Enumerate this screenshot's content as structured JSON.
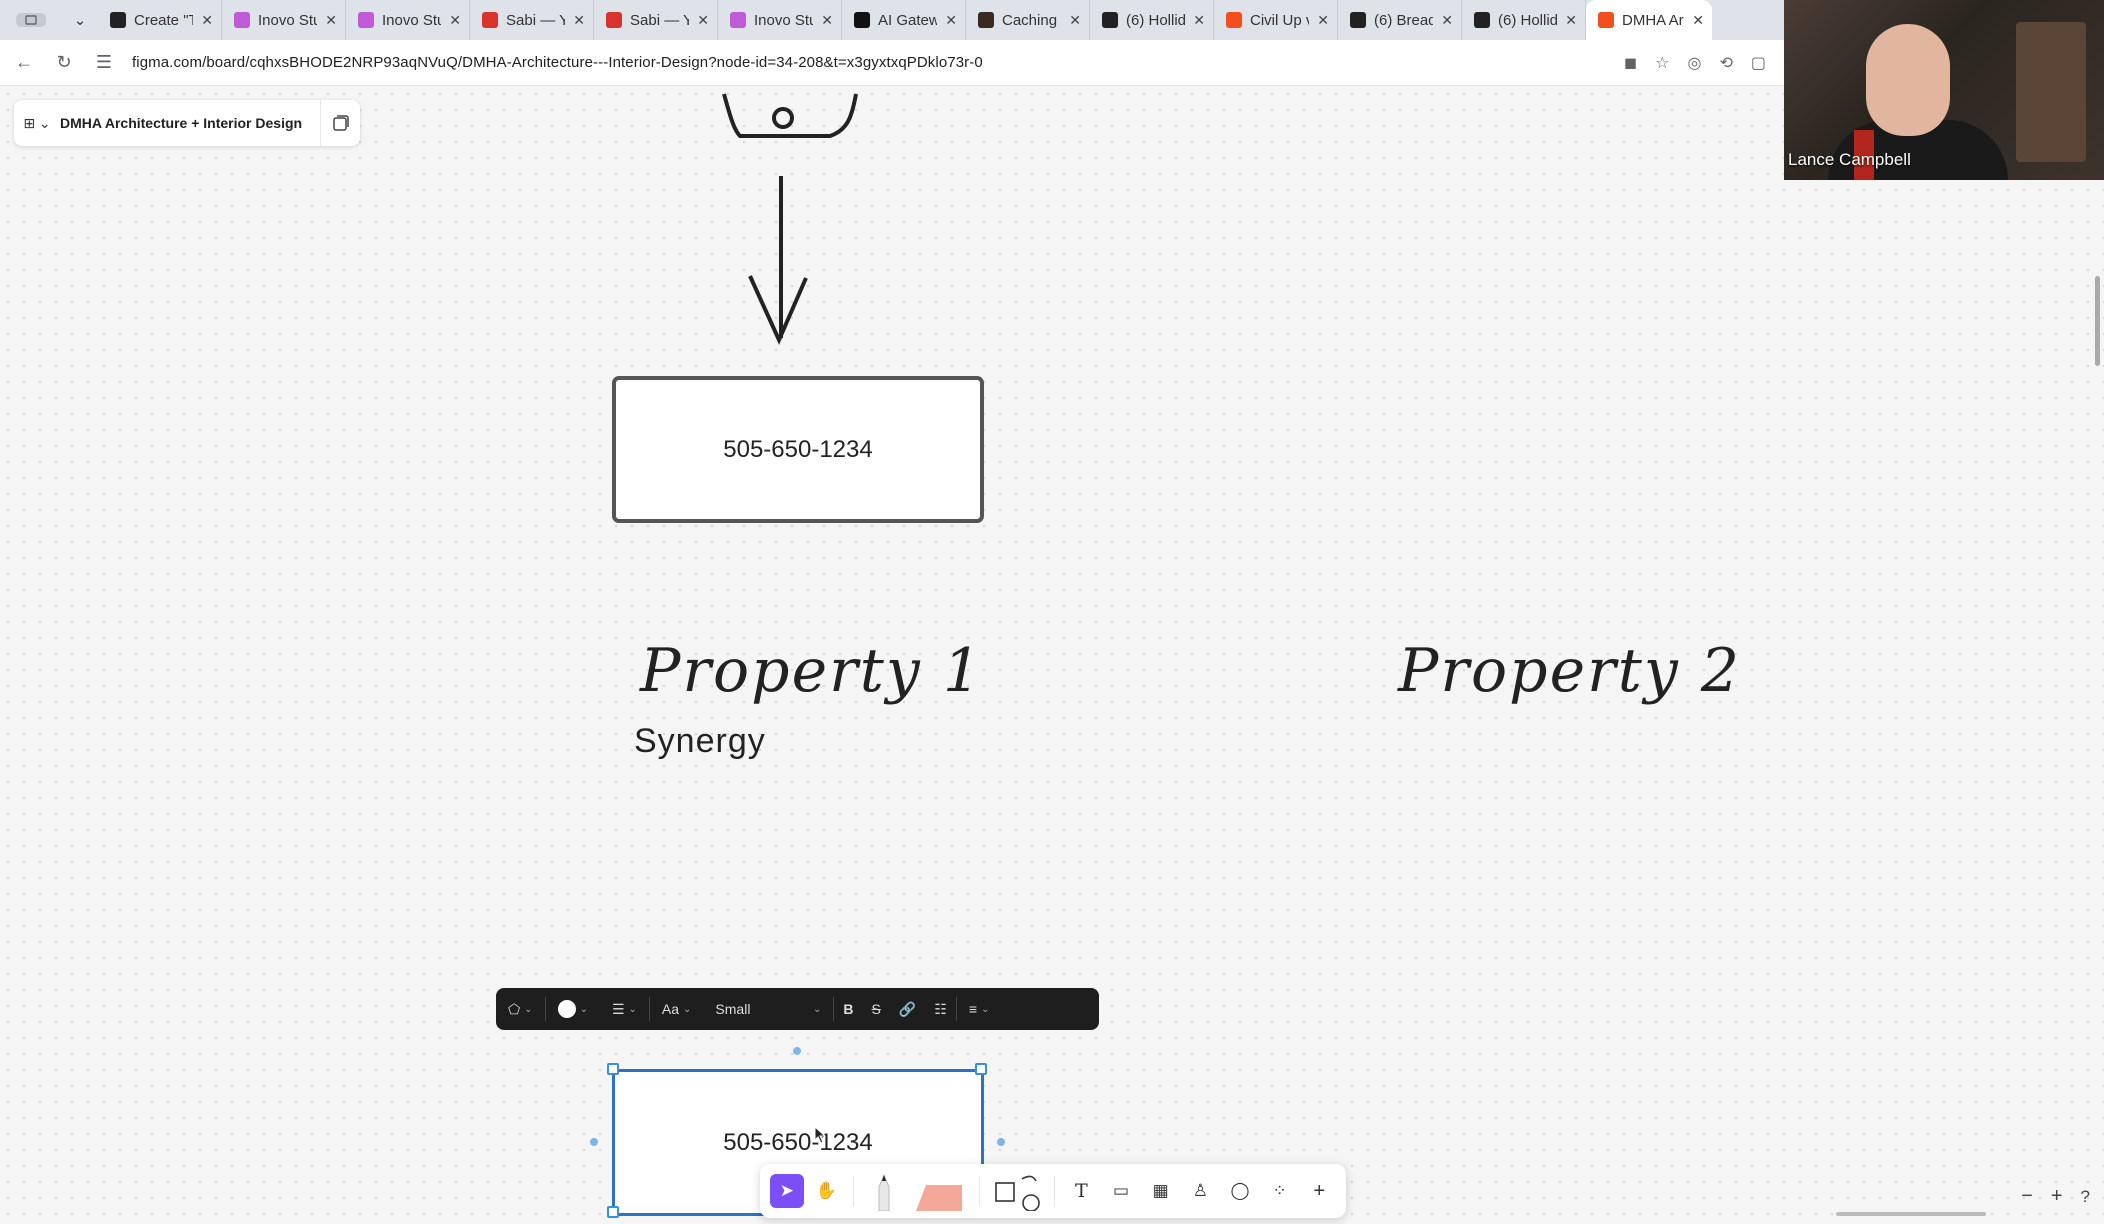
{
  "browser": {
    "tabs": [
      {
        "title": "Create \"T",
        "color": "#222"
      },
      {
        "title": "Inovo Stu",
        "color": "#c05bd8"
      },
      {
        "title": "Inovo Stu",
        "color": "#c05bd8"
      },
      {
        "title": "Sabi — Yo",
        "color": "#d9342b"
      },
      {
        "title": "Sabi — Yo",
        "color": "#d9342b"
      },
      {
        "title": "Inovo Stu",
        "color": "#c05bd8"
      },
      {
        "title": "AI Gatew",
        "color": "#111"
      },
      {
        "title": "Caching |",
        "color": "#3b2a22"
      },
      {
        "title": "(6) Hollid",
        "color": "#222"
      },
      {
        "title": "Civil Up v",
        "color": "#f24e1e"
      },
      {
        "title": "(6) Bread",
        "color": "#222"
      },
      {
        "title": "(6) Hollid",
        "color": "#222"
      },
      {
        "title": "DMHA Ar",
        "color": "#f24e1e"
      }
    ],
    "url": "figma.com/board/cqhxsBHODE2NRP93aqNVuQ/DMHA-Architecture---Interior-Design?node-id=34-208&t=x3gyxtxqPDklo73r-0"
  },
  "file": {
    "name": "DMHA Architecture + Interior Design"
  },
  "canvas": {
    "box_top_text": "505-650-1234",
    "property1": "Property 1",
    "property2": "Property 2",
    "synergy": "Synergy",
    "box_bottom_text": "505-650-1234"
  },
  "format_bar": {
    "font_size": "Small",
    "text_style": "Aa",
    "bold": "B",
    "strike": "S"
  },
  "toolbar": {
    "text_tool": "T",
    "add": "+"
  },
  "zoom": {
    "minus": "−",
    "plus": "+",
    "help": "?"
  },
  "video": {
    "participant": "Lance Campbell"
  }
}
